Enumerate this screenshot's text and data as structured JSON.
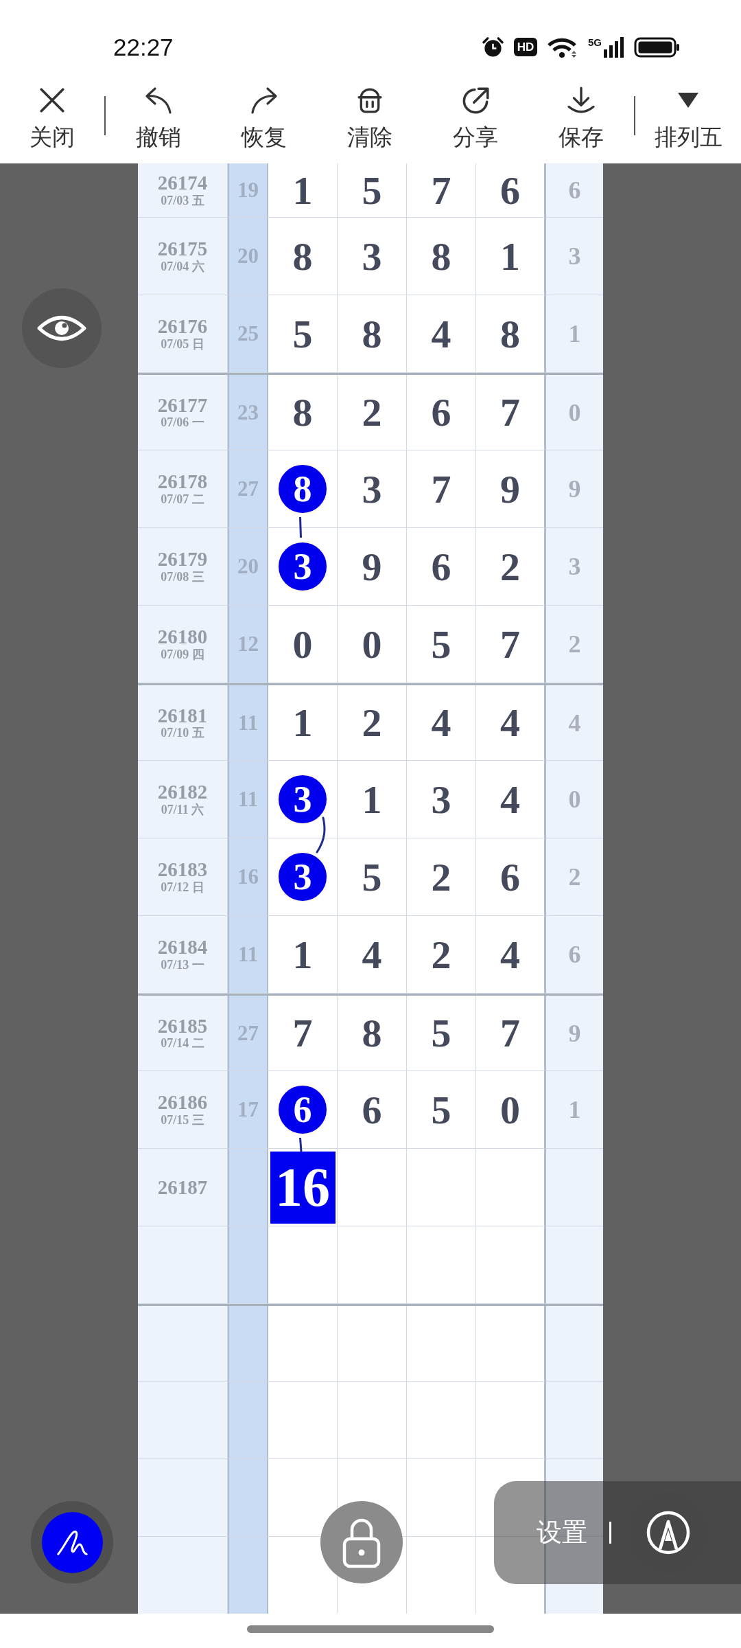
{
  "status_bar": {
    "time": "22:27",
    "hd_label": "HD",
    "network_type": "5G"
  },
  "toolbar": {
    "groups": [
      [
        {
          "kind": "close",
          "label": "关闭"
        }
      ],
      [
        {
          "kind": "undo",
          "label": "撤销"
        },
        {
          "kind": "redo",
          "label": "恢复"
        },
        {
          "kind": "clear",
          "label": "清除"
        },
        {
          "kind": "share",
          "label": "分享"
        },
        {
          "kind": "save",
          "label": "保存"
        }
      ],
      [
        {
          "kind": "dropdown",
          "label": "排列五"
        }
      ]
    ]
  },
  "table": {
    "rows": [
      {
        "issue": "26174",
        "date": "07/03 五",
        "column_2": "19",
        "digits": [
          {
            "value": "1",
            "kind": "plain"
          },
          {
            "value": "5",
            "kind": "plain"
          },
          {
            "value": "7",
            "kind": "plain"
          },
          {
            "value": "6",
            "kind": "plain"
          }
        ],
        "column_7": "6"
      },
      {
        "issue": "26175",
        "date": "07/04 六",
        "column_2": "20",
        "digits": [
          {
            "value": "8",
            "kind": "plain"
          },
          {
            "value": "3",
            "kind": "plain"
          },
          {
            "value": "8",
            "kind": "plain"
          },
          {
            "value": "1",
            "kind": "plain"
          }
        ],
        "column_7": "3"
      },
      {
        "issue": "26176",
        "date": "07/05 日",
        "column_2": "25",
        "digits": [
          {
            "value": "5",
            "kind": "plain"
          },
          {
            "value": "8",
            "kind": "plain"
          },
          {
            "value": "4",
            "kind": "plain"
          },
          {
            "value": "8",
            "kind": "plain"
          }
        ],
        "column_7": "1"
      },
      {
        "issue": "26177",
        "date": "07/06 一",
        "column_2": "23",
        "digits": [
          {
            "value": "8",
            "kind": "plain"
          },
          {
            "value": "2",
            "kind": "plain"
          },
          {
            "value": "6",
            "kind": "plain"
          },
          {
            "value": "7",
            "kind": "plain"
          }
        ],
        "column_7": "0"
      },
      {
        "issue": "26178",
        "date": "07/07 二",
        "column_2": "27",
        "digits": [
          {
            "value": "8",
            "kind": "circle"
          },
          {
            "value": "3",
            "kind": "plain"
          },
          {
            "value": "7",
            "kind": "plain"
          },
          {
            "value": "9",
            "kind": "plain"
          }
        ],
        "column_7": "9"
      },
      {
        "issue": "26179",
        "date": "07/08 三",
        "column_2": "20",
        "digits": [
          {
            "value": "3",
            "kind": "circle",
            "link_above": {
              "kind": "straight"
            }
          },
          {
            "value": "9",
            "kind": "plain"
          },
          {
            "value": "6",
            "kind": "plain"
          },
          {
            "value": "2",
            "kind": "plain"
          }
        ],
        "column_7": "3"
      },
      {
        "issue": "26180",
        "date": "07/09 四",
        "column_2": "12",
        "digits": [
          {
            "value": "0",
            "kind": "plain"
          },
          {
            "value": "0",
            "kind": "plain"
          },
          {
            "value": "5",
            "kind": "plain"
          },
          {
            "value": "7",
            "kind": "plain"
          }
        ],
        "column_7": "2"
      },
      {
        "issue": "26181",
        "date": "07/10 五",
        "column_2": "11",
        "digits": [
          {
            "value": "1",
            "kind": "plain"
          },
          {
            "value": "2",
            "kind": "plain"
          },
          {
            "value": "4",
            "kind": "plain"
          },
          {
            "value": "4",
            "kind": "plain"
          }
        ],
        "column_7": "4"
      },
      {
        "issue": "26182",
        "date": "07/11 六",
        "column_2": "11",
        "digits": [
          {
            "value": "3",
            "kind": "circle"
          },
          {
            "value": "1",
            "kind": "plain"
          },
          {
            "value": "3",
            "kind": "plain"
          },
          {
            "value": "4",
            "kind": "plain"
          }
        ],
        "column_7": "0"
      },
      {
        "issue": "26183",
        "date": "07/12 日",
        "column_2": "16",
        "digits": [
          {
            "value": "3",
            "kind": "circle",
            "link_above": {
              "kind": "curve"
            }
          },
          {
            "value": "5",
            "kind": "plain"
          },
          {
            "value": "2",
            "kind": "plain"
          },
          {
            "value": "6",
            "kind": "plain"
          }
        ],
        "column_7": "2"
      },
      {
        "issue": "26184",
        "date": "07/13 一",
        "column_2": "11",
        "digits": [
          {
            "value": "1",
            "kind": "plain"
          },
          {
            "value": "4",
            "kind": "plain"
          },
          {
            "value": "2",
            "kind": "plain"
          },
          {
            "value": "4",
            "kind": "plain"
          }
        ],
        "column_7": "6"
      },
      {
        "issue": "26185",
        "date": "07/14 二",
        "column_2": "27",
        "digits": [
          {
            "value": "7",
            "kind": "plain"
          },
          {
            "value": "8",
            "kind": "plain"
          },
          {
            "value": "5",
            "kind": "plain"
          },
          {
            "value": "7",
            "kind": "plain"
          }
        ],
        "column_7": "9"
      },
      {
        "issue": "26186",
        "date": "07/15 三",
        "column_2": "17",
        "digits": [
          {
            "value": "6",
            "kind": "circle"
          },
          {
            "value": "6",
            "kind": "plain"
          },
          {
            "value": "5",
            "kind": "plain"
          },
          {
            "value": "0",
            "kind": "plain"
          }
        ],
        "column_7": "1"
      },
      {
        "issue": "26187",
        "digits": [
          {
            "value": "16",
            "kind": "box",
            "link_above": {
              "kind": "straight"
            }
          }
        ]
      }
    ]
  },
  "settings_panel": {
    "label": "设置"
  }
}
